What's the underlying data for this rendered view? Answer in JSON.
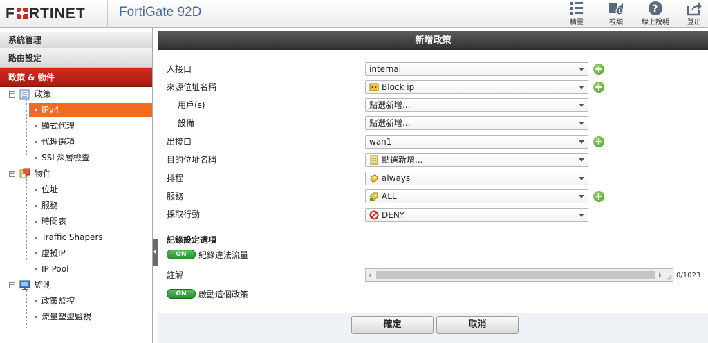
{
  "header": {
    "logo": "FORTINET",
    "product": "FortiGate 92D",
    "toolbar": [
      {
        "label": "精靈",
        "icon": "wizard-icon"
      },
      {
        "label": "視頻",
        "icon": "video-icon"
      },
      {
        "label": "線上說明",
        "icon": "help-icon"
      },
      {
        "label": "登出",
        "icon": "logout-icon"
      }
    ]
  },
  "sidebar": {
    "sections": [
      "系統管理",
      "路由設定",
      "政策 & 物件"
    ],
    "tree": {
      "policy": {
        "label": "政策",
        "children": [
          "IPv4",
          "顯式代理",
          "代理選項",
          "SSL深層檢查"
        ]
      },
      "objects": {
        "label": "物件",
        "children": [
          "位址",
          "服務",
          "時間表",
          "Traffic Shapers",
          "虛擬IP",
          "IP Pool"
        ]
      },
      "monitor": {
        "label": "監測",
        "children": [
          "政策監控",
          "流量塑型監視"
        ]
      }
    }
  },
  "main": {
    "title": "新增政策",
    "fields": {
      "incoming_interface": {
        "label": "入接口",
        "value": "internal"
      },
      "source_address": {
        "label": "來源位址名稱",
        "value": "Block ip"
      },
      "users": {
        "label": "用戶(s)",
        "value": "點選新增..."
      },
      "devices": {
        "label": "設備",
        "value": "點選新增..."
      },
      "outgoing_interface": {
        "label": "出接口",
        "value": "wan1"
      },
      "destination_address": {
        "label": "目的位址名稱",
        "value": "點選新增..."
      },
      "schedule": {
        "label": "排程",
        "value": "always"
      },
      "service": {
        "label": "服務",
        "value": "ALL"
      },
      "action": {
        "label": "採取行動",
        "value": "DENY"
      }
    },
    "logging": {
      "title": "記錄設定選項",
      "log_violation": {
        "toggle": "ON",
        "label": "紀錄違法流量",
        "enabled": true
      }
    },
    "comments": {
      "label": "註解",
      "value": "",
      "counter": "0/1023"
    },
    "enable_policy": {
      "toggle": "ON",
      "label": "啟動這個政策",
      "enabled": true
    },
    "buttons": {
      "ok": "確定",
      "cancel": "取消"
    }
  },
  "colors": {
    "accent_red": "#c0261a",
    "selected_orange": "#f26b21",
    "toggle_green": "#3aa63d",
    "add_green": "#4fa62a"
  }
}
